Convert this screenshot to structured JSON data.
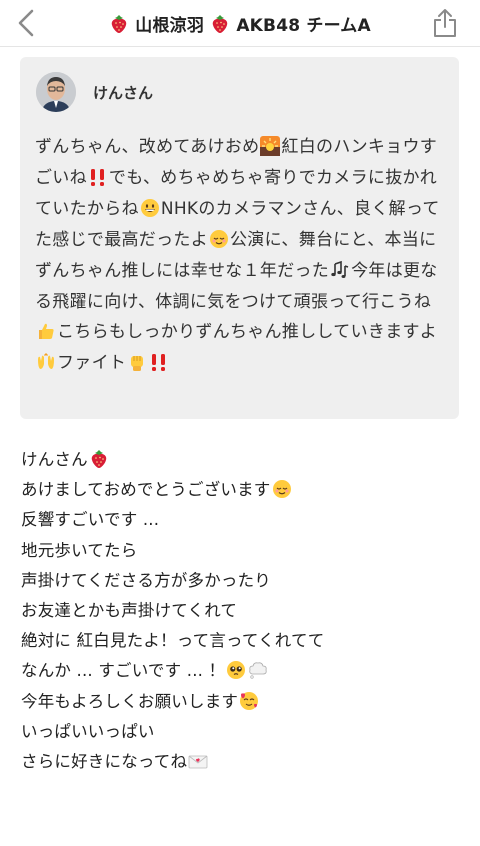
{
  "header": {
    "title": "山根涼羽",
    "subtitle": "AKB48 チームA",
    "berry_icon": "strawberry-icon",
    "back_icon": "chevron-left-icon",
    "share_icon": "share-icon"
  },
  "quote": {
    "author": "けんさん",
    "lines": [
      "ずんちゃん、改めてあけおめ",
      "紅白のハンキョウすごいね",
      "でも、めちゃめちゃ寄りでカメラに抜かれていたからね",
      "NHKのカメラマンさん、良く解ってた感じで最高だったよ",
      "公演に、舞台にと、本当にずんちゃん推しには幸せな１年だった",
      "今年は更なる飛躍に向け、体調に気をつけて頑張って行こうね",
      "こちらもしっかりずんちゃん推ししていきますよ",
      "ファイト"
    ]
  },
  "reply": {
    "lines": [
      "けんさん",
      "あけましておめでとうございます",
      "反響すごいです ...",
      "地元歩いてたら",
      "声掛けてくださる方が多かったり",
      "お友達とかも声掛けてくれて",
      "絶対に 紅白見たよ！って言ってくれてて",
      "なんか ... すごいです ... ！",
      "今年もよろしくお願いします",
      "いっぱいいっぱい",
      "さらに好きになってね"
    ]
  },
  "colors": {
    "quote_bg": "#efefef",
    "strawberry": "#d81e35",
    "text": "#222222"
  }
}
